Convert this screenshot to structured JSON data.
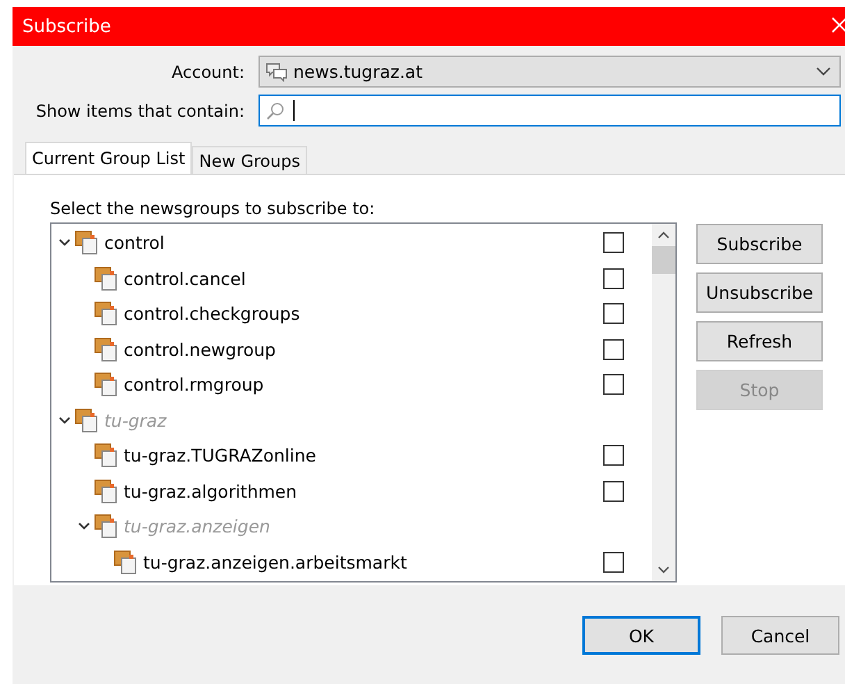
{
  "window": {
    "title": "Subscribe"
  },
  "account": {
    "label": "Account:",
    "value": "news.tugraz.at"
  },
  "filter": {
    "label": "Show items that contain:"
  },
  "tabs": [
    {
      "label": "Current Group List",
      "selected": true
    },
    {
      "label": "New Groups",
      "selected": false
    }
  ],
  "tree": {
    "label": "Select the newsgroups to subscribe to:",
    "items": [
      {
        "name": "control",
        "kind": "group",
        "checked": false,
        "expanded": true,
        "children": [
          {
            "name": "control.cancel",
            "kind": "group",
            "checked": false
          },
          {
            "name": "control.checkgroups",
            "kind": "group",
            "checked": false
          },
          {
            "name": "control.newgroup",
            "kind": "group",
            "checked": false
          },
          {
            "name": "control.rmgroup",
            "kind": "group",
            "checked": false
          }
        ]
      },
      {
        "name": "tu-graz",
        "kind": "folder",
        "expanded": true,
        "children": [
          {
            "name": "tu-graz.TUGRAZonline",
            "kind": "group",
            "checked": false
          },
          {
            "name": "tu-graz.algorithmen",
            "kind": "group",
            "checked": false
          },
          {
            "name": "tu-graz.anzeigen",
            "kind": "folder",
            "expanded": true,
            "children": [
              {
                "name": "tu-graz.anzeigen.arbeitsmarkt",
                "kind": "group",
                "checked": false
              }
            ]
          }
        ]
      }
    ]
  },
  "side_buttons": [
    {
      "label": "Subscribe",
      "disabled": false
    },
    {
      "label": "Unsubscribe",
      "disabled": false
    },
    {
      "label": "Refresh",
      "disabled": false
    },
    {
      "label": "Stop",
      "disabled": true
    }
  ],
  "buttons": [
    {
      "label": "OK",
      "default": true
    },
    {
      "label": "Cancel",
      "default": false
    }
  ]
}
